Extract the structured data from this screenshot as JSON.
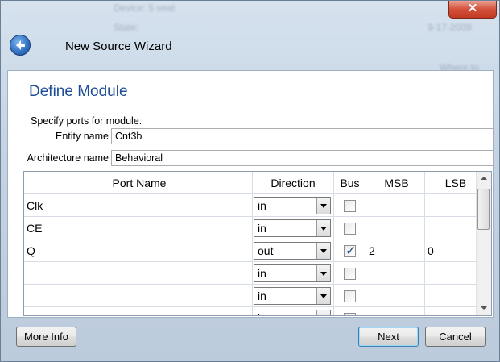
{
  "window": {
    "title": "New Source Wizard",
    "close_glyph": "✕",
    "background_text": [
      "Device: 5 seat",
      "State:",
      "9-17-2009",
      "Where to"
    ]
  },
  "page": {
    "heading": "Define Module",
    "instructions": "Specify ports for module.",
    "entity_label": "Entity name",
    "entity_value": "Cnt3b",
    "arch_label": "Architecture name",
    "arch_value": "Behavioral"
  },
  "table": {
    "headers": {
      "name": "Port Name",
      "direction": "Direction",
      "bus": "Bus",
      "msb": "MSB",
      "lsb": "LSB"
    },
    "rows": [
      {
        "name": "Clk",
        "direction": "in",
        "bus": false,
        "msb": "",
        "lsb": ""
      },
      {
        "name": "CE",
        "direction": "in",
        "bus": false,
        "msb": "",
        "lsb": ""
      },
      {
        "name": "Q",
        "direction": "out",
        "bus": true,
        "msb": "2",
        "lsb": "0"
      },
      {
        "name": "",
        "direction": "in",
        "bus": false,
        "msb": "",
        "lsb": ""
      },
      {
        "name": "",
        "direction": "in",
        "bus": false,
        "msb": "",
        "lsb": ""
      },
      {
        "name": "",
        "direction": "in",
        "bus": false,
        "msb": "",
        "lsb": ""
      }
    ]
  },
  "buttons": {
    "more_info": "More Info",
    "next": "Next",
    "cancel": "Cancel"
  },
  "icons": {
    "back": "back-arrow-icon",
    "close": "close-icon",
    "dropdown": "chevron-down-icon"
  },
  "colors": {
    "heading": "#1f4e99",
    "close_button": "#c23a22",
    "back_button": "#2f6fc2"
  }
}
